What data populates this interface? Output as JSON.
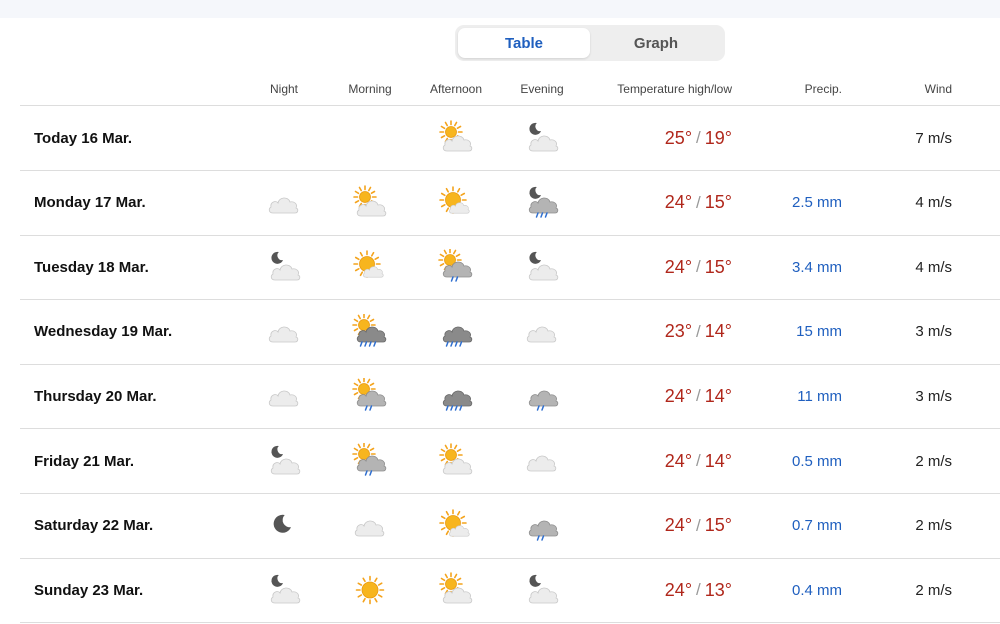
{
  "view_toggle": {
    "table_label": "Table",
    "graph_label": "Graph",
    "active": "Table"
  },
  "columns": {
    "night": "Night",
    "morning": "Morning",
    "afternoon": "Afternoon",
    "evening": "Evening",
    "temperature": "Temperature high/low",
    "precip": "Precip.",
    "wind": "Wind"
  },
  "colors": {
    "accent": "#1f5fbf",
    "temperature": "#b0271b",
    "precip": "#1f5fbf"
  },
  "days": [
    {
      "label": "Today 16 Mar.",
      "icons": {
        "night": "",
        "morning": "",
        "afternoon": "partly-cloudy-day-icon",
        "evening": "partly-cloudy-night-icon"
      },
      "high": "25°",
      "low": "19°",
      "precip": "",
      "wind": "7 m/s"
    },
    {
      "label": "Monday 17 Mar.",
      "icons": {
        "night": "cloudy-icon",
        "morning": "partly-cloudy-day-icon",
        "afternoon": "fair-day-icon",
        "evening": "night-rain-showers-icon"
      },
      "high": "24°",
      "low": "15°",
      "precip": "2.5 mm",
      "wind": "4 m/s"
    },
    {
      "label": "Tuesday 18 Mar.",
      "icons": {
        "night": "partly-cloudy-night-icon",
        "morning": "fair-day-icon",
        "afternoon": "day-rain-showers-icon",
        "evening": "partly-cloudy-night-icon"
      },
      "high": "24°",
      "low": "15°",
      "precip": "3.4 mm",
      "wind": "4 m/s"
    },
    {
      "label": "Wednesday 19 Mar.",
      "icons": {
        "night": "cloudy-icon",
        "morning": "day-heavy-rain-showers-icon",
        "afternoon": "heavy-rain-icon",
        "evening": "cloudy-icon"
      },
      "high": "23°",
      "low": "14°",
      "precip": "15 mm",
      "wind": "3 m/s"
    },
    {
      "label": "Thursday 20 Mar.",
      "icons": {
        "night": "cloudy-icon",
        "morning": "day-rain-showers-icon",
        "afternoon": "heavy-rain-icon",
        "evening": "rain-icon"
      },
      "high": "24°",
      "low": "14°",
      "precip": "11 mm",
      "wind": "3 m/s"
    },
    {
      "label": "Friday 21 Mar.",
      "icons": {
        "night": "partly-cloudy-night-icon",
        "morning": "day-rain-showers-icon",
        "afternoon": "partly-cloudy-day-icon",
        "evening": "cloudy-icon"
      },
      "high": "24°",
      "low": "14°",
      "precip": "0.5 mm",
      "wind": "2 m/s"
    },
    {
      "label": "Saturday 22 Mar.",
      "icons": {
        "night": "clear-night-icon",
        "morning": "cloudy-icon",
        "afternoon": "fair-day-icon",
        "evening": "rain-icon"
      },
      "high": "24°",
      "low": "15°",
      "precip": "0.7 mm",
      "wind": "2 m/s"
    },
    {
      "label": "Sunday 23 Mar.",
      "icons": {
        "night": "partly-cloudy-night-icon",
        "morning": "clear-day-icon",
        "afternoon": "partly-cloudy-day-icon",
        "evening": "partly-cloudy-night-icon"
      },
      "high": "24°",
      "low": "13°",
      "precip": "0.4 mm",
      "wind": "2 m/s"
    }
  ]
}
